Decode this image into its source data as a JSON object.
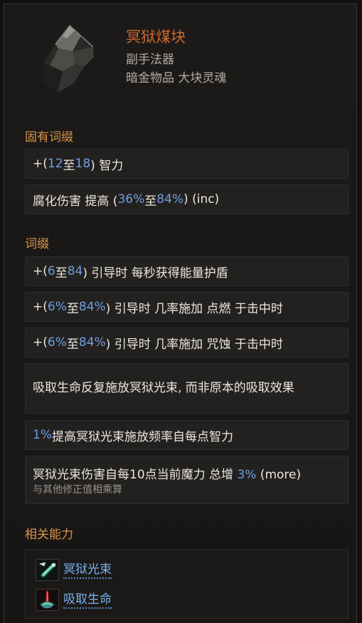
{
  "item": {
    "name": "冥狱煤块",
    "type": "副手法器",
    "subtitle": "暗金物品 大块灵魂",
    "icon": "coal-lump-icon"
  },
  "implicit": {
    "title": "固有词缀",
    "rows": [
      {
        "pre": "+(",
        "a": "12",
        "mid": " 至 ",
        "b": "18",
        "post": ") 智力"
      },
      {
        "pre": "腐化伤害 提高 (",
        "a": "36%",
        "mid": " 至 ",
        "b": "84%",
        "post": ") (inc)"
      }
    ]
  },
  "affixes": {
    "title": "词缀",
    "rows": [
      {
        "pre": "+(",
        "a": "6",
        "mid": " 至 ",
        "b": "84",
        "post": ") 引导时 每秒获得能量护盾"
      },
      {
        "pre": "+(",
        "a": "6%",
        "mid": " 至 ",
        "b": "84%",
        "post": ") 引导时 几率施加 点燃 于击中时"
      },
      {
        "pre": "+(",
        "a": "6%",
        "mid": " 至 ",
        "b": "84%",
        "post": ") 引导时 几率施加 咒蚀 于击中时"
      }
    ],
    "drain_text": "吸取生命反复施放冥狱光束, 而非原本的吸取效果",
    "freq": {
      "value": "1%",
      "text": " 提高冥狱光束施放频率自每点智力"
    },
    "dmg": {
      "pre": "冥狱光束伤害自每10点当前魔力 总增 ",
      "value": "3%",
      "post": " (more)",
      "note": "与其他修正值相乘算"
    }
  },
  "related": {
    "title": "相关能力",
    "skills": [
      {
        "name": "冥狱光束",
        "icon": "nether-beam-icon"
      },
      {
        "name": "吸取生命",
        "icon": "drain-life-icon"
      }
    ]
  },
  "colors": {
    "item_name": "#d2672f",
    "section_title": "#d9944a",
    "value_blue": "#6f9fe0",
    "link_blue": "#7ab1f0"
  }
}
